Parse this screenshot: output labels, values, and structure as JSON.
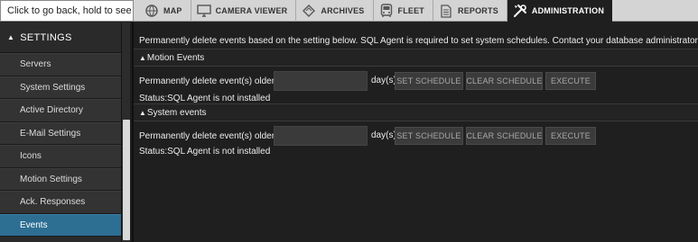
{
  "topbar": {
    "back_hint": "Click to go back, hold to see history",
    "tabs": [
      {
        "label": "MAP",
        "icon": "globe-icon"
      },
      {
        "label": "CAMERA VIEWER",
        "icon": "monitor-icon"
      },
      {
        "label": "ARCHIVES",
        "icon": "archives-icon"
      },
      {
        "label": "FLEET",
        "icon": "bus-icon"
      },
      {
        "label": "REPORTS",
        "icon": "report-icon"
      },
      {
        "label": "ADMINISTRATION",
        "icon": "tools-icon",
        "active": true
      }
    ]
  },
  "sidebar": {
    "header": "SETTINGS",
    "header_icon": "triangle-up-icon",
    "items": [
      {
        "label": "Servers"
      },
      {
        "label": "System Settings"
      },
      {
        "label": "Active Directory"
      },
      {
        "label": "E-Mail Settings"
      },
      {
        "label": "Icons"
      },
      {
        "label": "Motion Settings"
      },
      {
        "label": "Ack. Responses"
      },
      {
        "label": "Events",
        "selected": true
      }
    ]
  },
  "main": {
    "intro": "Permanently delete events based on the setting below. SQL Agent is required to set system schedules. Contact your database administrator for more information",
    "sections": [
      {
        "title": "Motion Events",
        "row_label": "Permanently delete event(s) older than",
        "input_value": "",
        "unit": "day(s)",
        "buttons": {
          "set": "SET SCHEDULE",
          "clear": "CLEAR SCHEDULE",
          "execute": "EXECUTE"
        },
        "status": "Status:SQL Agent is not installed"
      },
      {
        "title": "System events",
        "row_label": "Permanently delete event(s) older than",
        "input_value": "",
        "unit": "day(s)",
        "buttons": {
          "set": "SET SCHEDULE",
          "clear": "CLEAR SCHEDULE",
          "execute": "EXECUTE"
        },
        "status": "Status:SQL Agent is not installed"
      }
    ]
  },
  "colors": {
    "selected_item": "#2d6e93",
    "active_tab_bg": "#1f1f1f",
    "topbar_bg": "#d4d4d4",
    "panel_bg": "#1f1f1f"
  }
}
